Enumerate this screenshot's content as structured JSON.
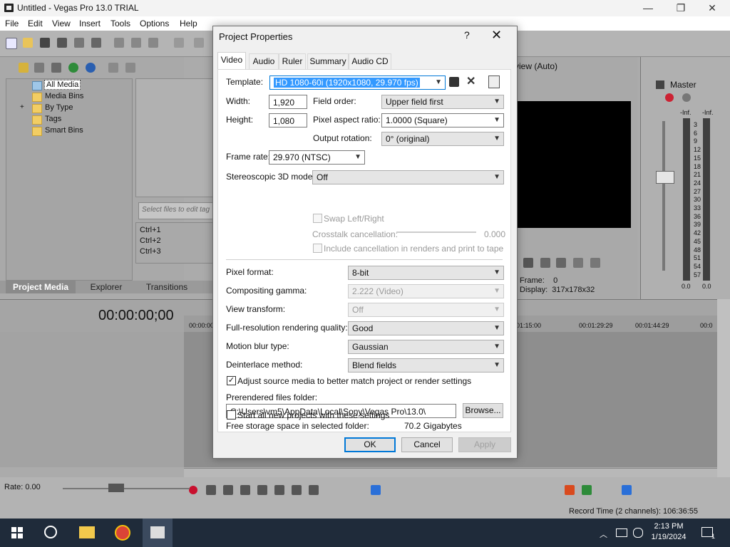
{
  "window": {
    "title": "Untitled - Vegas Pro 13.0 TRIAL",
    "minimize": "—",
    "maximize": "❐",
    "close": "✕"
  },
  "menu": [
    "File",
    "Edit",
    "View",
    "Insert",
    "Tools",
    "Options",
    "Help"
  ],
  "media_tree": {
    "items": [
      "All Media",
      "Media Bins",
      "By Type",
      "Tags",
      "Smart Bins"
    ],
    "expander": "+",
    "search_placeholder": "Select files to edit tag",
    "shortcuts": [
      "Ctrl+1",
      "Ctrl+2",
      "Ctrl+3"
    ]
  },
  "left_tabs": [
    "Project Media",
    "Explorer",
    "Transitions"
  ],
  "timeline": {
    "timecode": "00:00:00;00",
    "ruler_labels": [
      "00:00:00",
      "01:15:00",
      "00:01:29:29",
      "00:01:44:29",
      "00:0"
    ],
    "rate": "Rate: 0.00",
    "record_time": "Record Time (2 channels): 106:36:55"
  },
  "preview": {
    "quality": "view (Auto)",
    "frame": "Frame:",
    "frame_value": "0",
    "display": "Display:",
    "display_value": "317x178x32"
  },
  "master": {
    "title": "Master",
    "inf_left": "-Inf.",
    "inf_right": "-Inf.",
    "scale": [
      "3",
      "6",
      "9",
      "12",
      "15",
      "18",
      "21",
      "24",
      "27",
      "30",
      "33",
      "36",
      "39",
      "42",
      "45",
      "48",
      "51",
      "54",
      "57"
    ],
    "value_left": "0.0",
    "value_right": "0.0"
  },
  "taskbar": {
    "time": "2:13 PM",
    "date": "1/19/2024",
    "notifications": "1"
  },
  "dialog": {
    "title": "Project Properties",
    "help": "?",
    "close": "✕",
    "tabs": [
      "Video",
      "Audio",
      "Ruler",
      "Summary",
      "Audio CD"
    ],
    "active_tab": "Video",
    "template_label": "Template:",
    "template_value": "HD 1080-60i (1920x1080, 29.970 fps)",
    "width_label": "Width:",
    "width_value": "1,920",
    "height_label": "Height:",
    "height_value": "1,080",
    "field_order_label": "Field order:",
    "field_order_value": "Upper field first",
    "par_label": "Pixel aspect ratio:",
    "par_value": "1.0000 (Square)",
    "rotation_label": "Output rotation:",
    "rotation_value": "0° (original)",
    "framerate_label": "Frame rate:",
    "framerate_value": "29.970 (NTSC)",
    "stereo_label": "Stereoscopic 3D mode:",
    "stereo_value": "Off",
    "swap_label": "Swap Left/Right",
    "crosstalk_label": "Crosstalk cancellation:",
    "crosstalk_value": "0.000",
    "include_cancel_label": "Include cancellation in renders and print to tape",
    "pixel_format_label": "Pixel format:",
    "pixel_format_value": "8-bit",
    "gamma_label": "Compositing gamma:",
    "gamma_value": "2.222 (Video)",
    "view_transform_label": "View transform:",
    "view_transform_value": "Off",
    "render_quality_label": "Full-resolution rendering quality:",
    "render_quality_value": "Good",
    "motion_blur_label": "Motion blur type:",
    "motion_blur_value": "Gaussian",
    "deinterlace_label": "Deinterlace method:",
    "deinterlace_value": "Blend fields",
    "adjust_label": "Adjust source media to better match project or render settings",
    "adjust_checked": true,
    "prerendered_label": "Prerendered files folder:",
    "prerendered_value": "C:\\Users\\vm5\\AppData\\Local\\Sony\\Vegas Pro\\13.0\\",
    "browse": "Browse...",
    "free_storage_label": "Free storage space in selected folder:",
    "free_storage_value": "70.2 Gigabytes",
    "start_all_label": "Start all new projects with these settings",
    "ok": "OK",
    "cancel": "Cancel",
    "apply": "Apply"
  },
  "colors": {
    "accent": "#0078d7",
    "selection": "#3399ff",
    "taskbar": "#1f2b3a"
  }
}
